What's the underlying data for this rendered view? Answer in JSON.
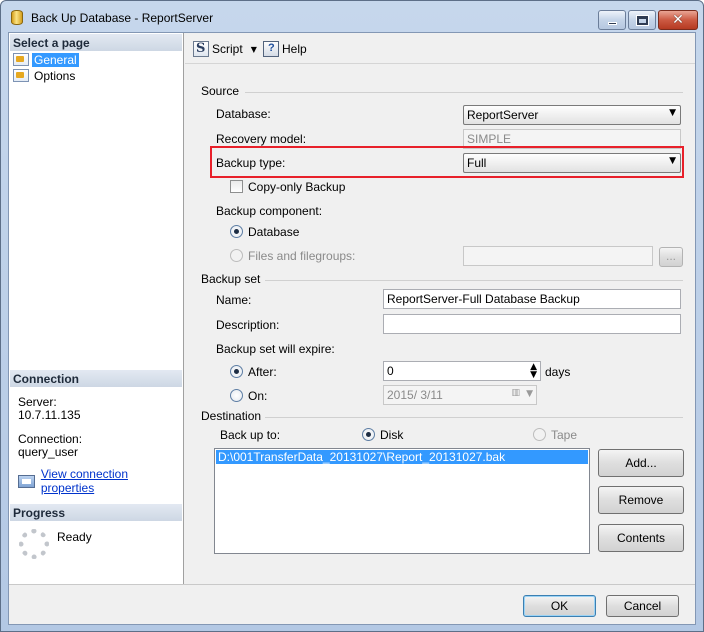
{
  "window": {
    "title": "Back Up Database - ReportServer",
    "close_glyph": "✕"
  },
  "left_pane": {
    "select_page_header": "Select a page",
    "pages": [
      {
        "label": "General",
        "selected": true
      },
      {
        "label": "Options",
        "selected": false
      }
    ],
    "connection_header": "Connection",
    "server_label": "Server:",
    "server_value": "10.7.11.135",
    "connection_label": "Connection:",
    "connection_value": "query_user",
    "view_connection_link": "View connection properties",
    "progress_header": "Progress",
    "progress_status": "Ready"
  },
  "toolbar": {
    "script_label": "Script",
    "script_dropdown_glyph": "▼",
    "help_label": "Help"
  },
  "source": {
    "section_label": "Source",
    "database_label": "Database:",
    "database_value": "ReportServer",
    "recovery_model_label": "Recovery model:",
    "recovery_model_value": "SIMPLE",
    "backup_type_label": "Backup type:",
    "backup_type_value": "Full",
    "copy_only_label": "Copy-only Backup",
    "copy_only_checked": false,
    "backup_component_label": "Backup component:",
    "component_database_label": "Database",
    "component_files_label": "Files and filegroups:",
    "files_browse_label": "...",
    "selected_component": "Database"
  },
  "backup_set": {
    "section_label": "Backup set",
    "name_label": "Name:",
    "name_value": "ReportServer-Full Database Backup",
    "description_label": "Description:",
    "description_value": "",
    "expire_label": "Backup set will expire:",
    "after_label": "After:",
    "after_value": "0",
    "days_label": "days",
    "on_label": "On:",
    "on_value": "2015/  3/11",
    "selected_expiry": "After"
  },
  "destination": {
    "section_label": "Destination",
    "back_up_to_label": "Back up to:",
    "disk_label": "Disk",
    "tape_label": "Tape",
    "selected_media": "Disk",
    "paths": [
      "D:\\001TransferData_20131027\\Report_20131027.bak"
    ],
    "add_button": "Add...",
    "remove_button": "Remove",
    "contents_button": "Contents"
  },
  "footer": {
    "ok_button": "OK",
    "cancel_button": "Cancel"
  },
  "colors": {
    "highlight_box": "#e8202a",
    "selection": "#3399ff",
    "link": "#0033cc"
  },
  "combo_arrow_glyph": "▼"
}
